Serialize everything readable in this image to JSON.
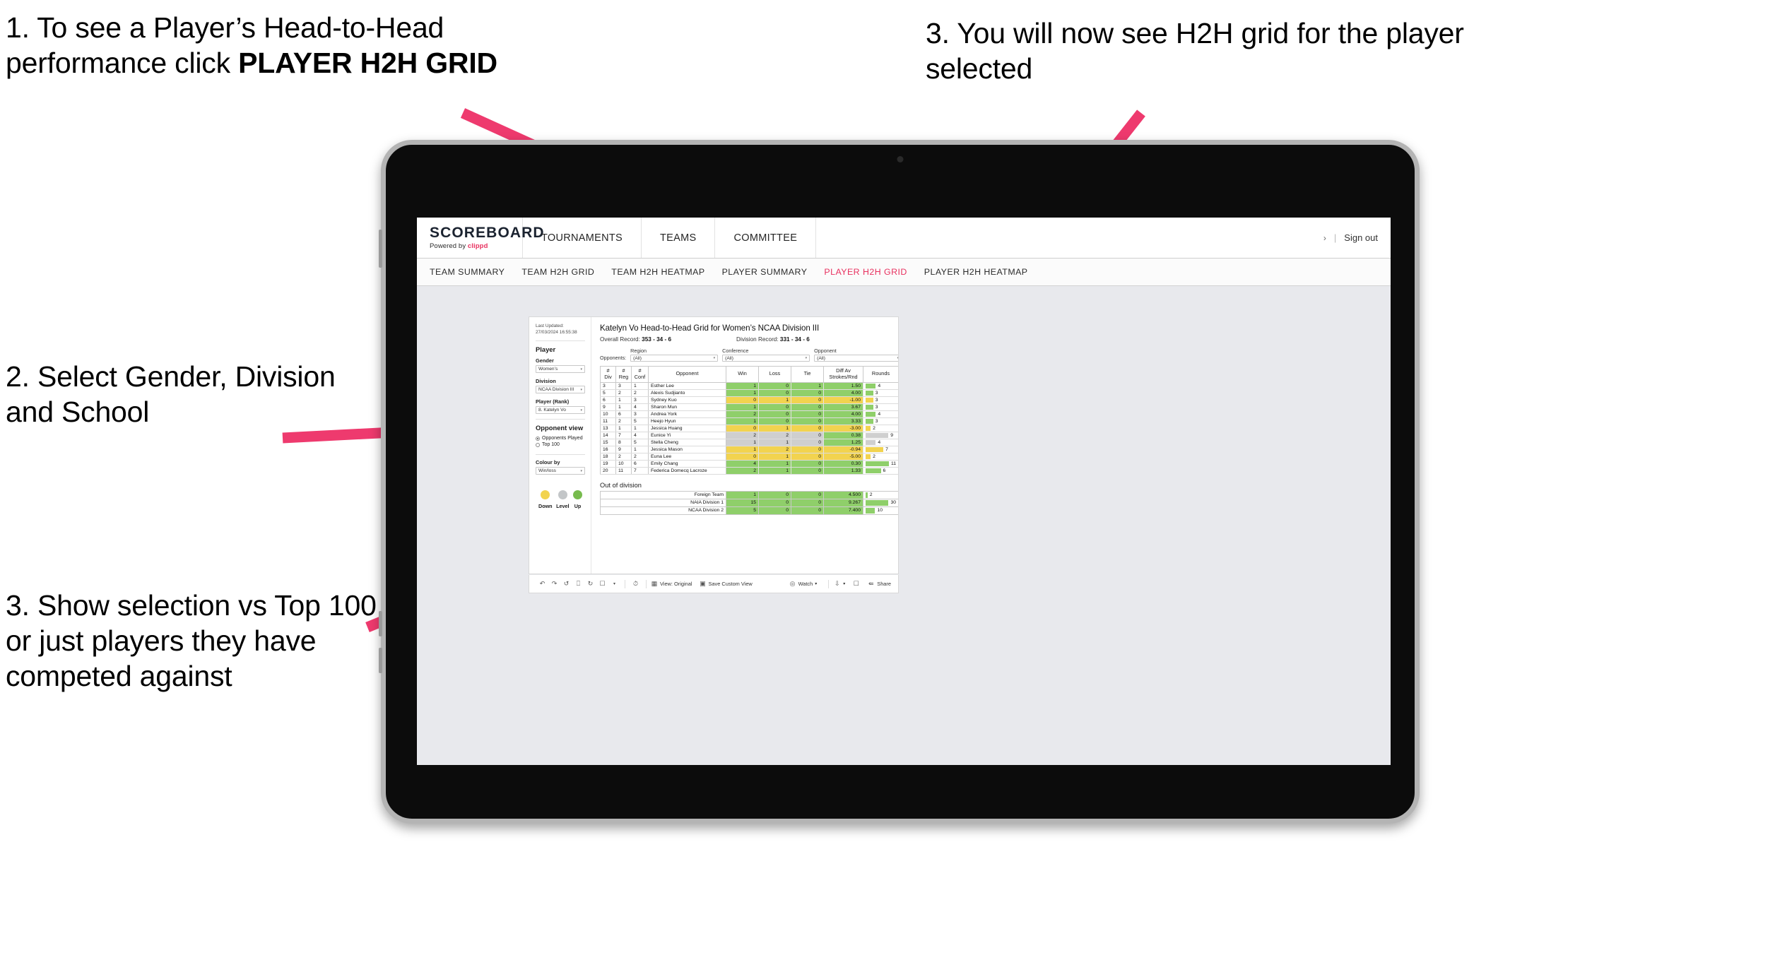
{
  "annotations": [
    {
      "id": "callout-1",
      "pre": "1. To see a Player’s Head-to-Head performance click ",
      "bold": "PLAYER H2H GRID"
    },
    {
      "id": "callout-2",
      "text": "2. Select Gender, Division and School"
    },
    {
      "id": "callout-3",
      "text": "3. Show selection vs Top 100 or just players they have competed against"
    },
    {
      "id": "callout-4",
      "text": "3. You will now see H2H grid for the player selected"
    }
  ],
  "colors": {
    "accent_pink": "#e8315f",
    "arrow_pink": "#ee3a6e",
    "win_green": "#8fcf6a",
    "loss_yellow": "#f2d34f",
    "tie_grey": "#cfcfcf",
    "canvas_bg": "#e8e9ed",
    "tablet_body": "#0c0c0c",
    "tablet_edge": "#b4b4b4"
  },
  "brand": {
    "logo": "SCOREBOARD",
    "powered_prefix": "Powered by ",
    "powered_name": "clippd"
  },
  "topnav": {
    "items": [
      "TOURNAMENTS",
      "TEAMS",
      "COMMITTEE"
    ],
    "chevron": "›",
    "separator": "|",
    "signout": "Sign out"
  },
  "subnav": {
    "items": [
      {
        "label": "TEAM SUMMARY",
        "active": false
      },
      {
        "label": "TEAM H2H GRID",
        "active": false
      },
      {
        "label": "TEAM H2H HEATMAP",
        "active": false
      },
      {
        "label": "PLAYER SUMMARY",
        "active": false
      },
      {
        "label": "PLAYER H2H GRID",
        "active": true
      },
      {
        "label": "PLAYER H2H HEATMAP",
        "active": false
      }
    ]
  },
  "pane": {
    "last_updated": "Last Updated: 27/03/2024 16:55:38",
    "player_heading": "Player",
    "fields": [
      {
        "label": "Gender",
        "value": "Women’s"
      },
      {
        "label": "Division",
        "value": "NCAA Division III"
      },
      {
        "label": "Player (Rank)",
        "value": "8. Katelyn Vo"
      }
    ],
    "opponent_view_heading": "Opponent view",
    "opponent_view_options": [
      {
        "label": "Opponents Played",
        "selected": true
      },
      {
        "label": "Top 100",
        "selected": false
      }
    ],
    "colour_by_label": "Colour by",
    "colour_by_value": "Win/loss",
    "legend": [
      {
        "label": "Down",
        "color": "#f2d34f"
      },
      {
        "label": "Level",
        "color": "#c3c6c8"
      },
      {
        "label": "Up",
        "color": "#77bb4e"
      }
    ],
    "caret": "▾"
  },
  "viz": {
    "title": "Katelyn Vo Head-to-Head Grid for Women’s NCAA Division III",
    "overall_record_label": "Overall Record: ",
    "overall_record_value": "353 -  34 - 6",
    "division_record_label": "Division Record: ",
    "division_record_value": "331 -  34 - 6",
    "opponents_label": "Opponents:",
    "opponent_filters": [
      {
        "label": "Region",
        "value": "(All)"
      },
      {
        "label": "Conference",
        "value": "(All)"
      },
      {
        "label": "Opponent",
        "value": "(All)"
      }
    ],
    "out_of_division_title": "Out of division"
  },
  "chart_data": {
    "type": "table",
    "title": "Katelyn Vo Head-to-Head Grid for Women’s NCAA Division III",
    "columns": [
      "# Div",
      "# Reg",
      "# Conf",
      "Opponent",
      "Win",
      "Loss",
      "Tie",
      "Diff Av Strokes/Rnd",
      "Rounds"
    ],
    "column_header_lines": [
      [
        "#",
        "Div"
      ],
      [
        "#",
        "Reg"
      ],
      [
        "#",
        "Conf"
      ],
      [
        "Opponent",
        ""
      ],
      [
        "Win",
        ""
      ],
      [
        "Loss",
        ""
      ],
      [
        "Tie",
        ""
      ],
      [
        "Diff Av",
        "Strokes/Rnd"
      ],
      [
        "Rounds",
        ""
      ]
    ],
    "rounds_axis_max": 12,
    "rows": [
      {
        "div": "3",
        "reg": "3",
        "conf": "1",
        "opponent": "Esther Lee",
        "win": "1",
        "loss": "0",
        "tie": "1",
        "diff": "1.50",
        "rounds": "4",
        "state": "up"
      },
      {
        "div": "5",
        "reg": "2",
        "conf": "2",
        "opponent": "Alexis Sudjianto",
        "win": "1",
        "loss": "0",
        "tie": "0",
        "diff": "4.00",
        "rounds": "3",
        "state": "up"
      },
      {
        "div": "6",
        "reg": "1",
        "conf": "3",
        "opponent": "Sydney Kuo",
        "win": "0",
        "loss": "1",
        "tie": "0",
        "diff": "-1.00",
        "rounds": "3",
        "state": "down"
      },
      {
        "div": "9",
        "reg": "1",
        "conf": "4",
        "opponent": "Sharon Mun",
        "win": "1",
        "loss": "0",
        "tie": "0",
        "diff": "3.67",
        "rounds": "3",
        "state": "up"
      },
      {
        "div": "10",
        "reg": "6",
        "conf": "3",
        "opponent": "Andrea York",
        "win": "2",
        "loss": "0",
        "tie": "0",
        "diff": "4.00",
        "rounds": "4",
        "state": "up"
      },
      {
        "div": "11",
        "reg": "2",
        "conf": "5",
        "opponent": "Heejo Hyun",
        "win": "1",
        "loss": "0",
        "tie": "0",
        "diff": "3.33",
        "rounds": "3",
        "state": "up"
      },
      {
        "div": "13",
        "reg": "1",
        "conf": "1",
        "opponent": "Jessica Huang",
        "win": "0",
        "loss": "1",
        "tie": "0",
        "diff": "-3.00",
        "rounds": "2",
        "state": "down"
      },
      {
        "div": "14",
        "reg": "7",
        "conf": "4",
        "opponent": "Eunice Yi",
        "win": "2",
        "loss": "2",
        "tie": "0",
        "diff": "0.38",
        "rounds": "9",
        "state": "level",
        "diff_state": "up"
      },
      {
        "div": "15",
        "reg": "8",
        "conf": "5",
        "opponent": "Stella Cheng",
        "win": "1",
        "loss": "1",
        "tie": "0",
        "diff": "1.25",
        "rounds": "4",
        "state": "level",
        "diff_state": "up"
      },
      {
        "div": "16",
        "reg": "9",
        "conf": "1",
        "opponent": "Jessica Mason",
        "win": "1",
        "loss": "2",
        "tie": "0",
        "diff": "-0.94",
        "rounds": "7",
        "state": "down"
      },
      {
        "div": "18",
        "reg": "2",
        "conf": "2",
        "opponent": "Euna Lee",
        "win": "0",
        "loss": "1",
        "tie": "0",
        "diff": "-5.00",
        "rounds": "2",
        "state": "down"
      },
      {
        "div": "19",
        "reg": "10",
        "conf": "6",
        "opponent": "Emily Chang",
        "win": "4",
        "loss": "1",
        "tie": "0",
        "diff": "0.30",
        "rounds": "11",
        "state": "up"
      },
      {
        "div": "20",
        "reg": "11",
        "conf": "7",
        "opponent": "Federica Domecq Lacroze",
        "win": "2",
        "loss": "1",
        "tie": "0",
        "diff": "1.33",
        "rounds": "6",
        "state": "up"
      }
    ],
    "out_of_division": {
      "title": "Out of division",
      "rounds_axis_max": 32,
      "rows": [
        {
          "name": "Foreign Team",
          "win": "1",
          "loss": "0",
          "tie": "0",
          "diff": "4.500",
          "rounds": "2",
          "state": "up"
        },
        {
          "name": "NAIA Division 1",
          "win": "15",
          "loss": "0",
          "tie": "0",
          "diff": "9.267",
          "rounds": "30",
          "state": "up"
        },
        {
          "name": "NCAA Division 2",
          "win": "5",
          "loss": "0",
          "tie": "0",
          "diff": "7.400",
          "rounds": "10",
          "state": "up"
        }
      ]
    }
  },
  "toolbar": {
    "view_label": "View: Original",
    "save_label": "Save Custom View",
    "watch_label": "Watch",
    "share_label": "Share",
    "caret": "▾"
  }
}
